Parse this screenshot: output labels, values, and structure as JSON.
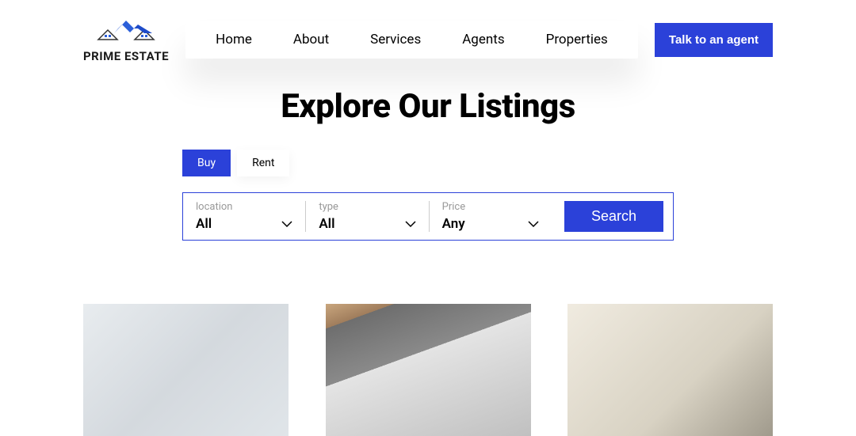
{
  "brand": {
    "name": "PRIME ESTATE"
  },
  "nav": {
    "items": [
      "Home",
      "About",
      "Services",
      "Agents",
      "Properties"
    ]
  },
  "cta": {
    "label": "Talk to an agent"
  },
  "hero": {
    "title": "Explore Our Listings"
  },
  "tabs": {
    "buy": "Buy",
    "rent": "Rent"
  },
  "search": {
    "location": {
      "label": "location",
      "value": "All"
    },
    "type": {
      "label": "type",
      "value": "All"
    },
    "price": {
      "label": "Price",
      "value": "Any"
    },
    "button": "Search"
  },
  "colors": {
    "primary": "#2b41d9"
  }
}
